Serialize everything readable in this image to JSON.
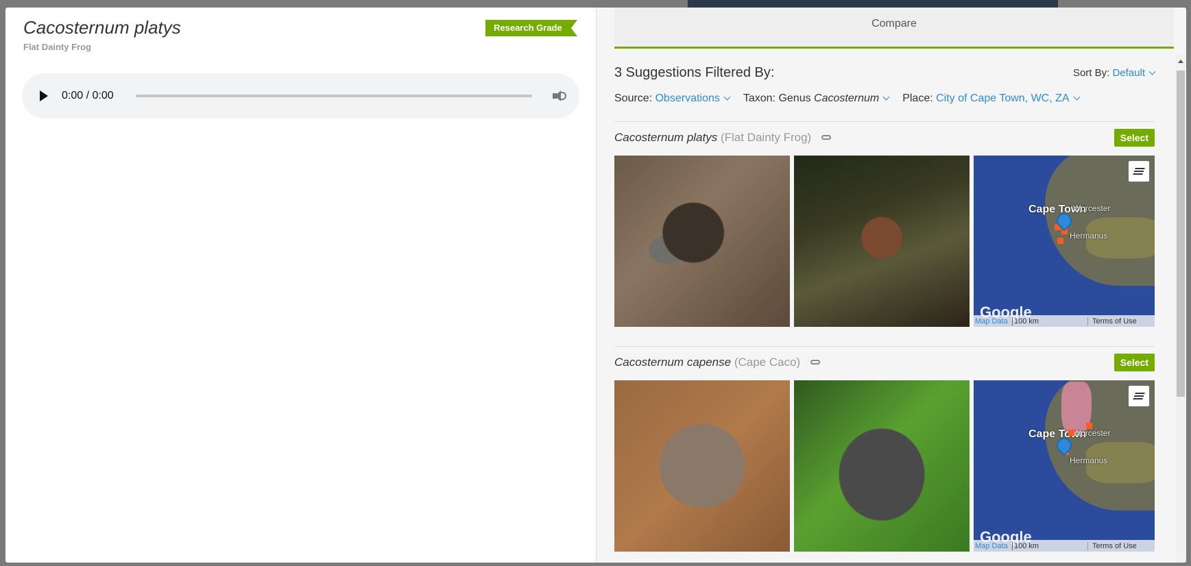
{
  "observation": {
    "scientific_name": "Cacosternum platys",
    "common_name": "Flat Dainty Frog",
    "quality_badge": "Research Grade",
    "audio_time": "0:00 / 0:00"
  },
  "compare": {
    "tab_label": "Compare",
    "suggestions_title": "3 Suggestions Filtered By:",
    "sort_label": "Sort By:",
    "sort_value": "Default",
    "filters": {
      "source_label": "Source:",
      "source_value": "Observations",
      "taxon_label": "Taxon:",
      "taxon_rank": "Genus",
      "taxon_value": "Cacosternum",
      "place_label": "Place:",
      "place_value": "City of Cape Town, WC, ZA"
    },
    "suggestions": [
      {
        "scientific_name": "Cacosternum platys",
        "common_name": "(Flat Dainty Frog)",
        "select_label": "Select"
      },
      {
        "scientific_name": "Cacosternum capense",
        "common_name": "(Cape Caco)",
        "select_label": "Select"
      }
    ],
    "map": {
      "label_city": "Cape Town",
      "label_worcester": "Worcester",
      "label_hermanus": "Hermanus",
      "google": "Google",
      "map_data": "Map Data",
      "scale": "100 km",
      "terms": "Terms of Use"
    }
  },
  "colors": {
    "accent_green": "#74ac00",
    "link_blue": "#2e8ad9"
  }
}
